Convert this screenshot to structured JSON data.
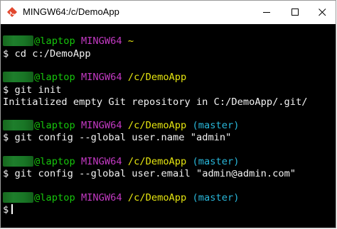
{
  "window": {
    "title": "MINGW64:/c/DemoApp"
  },
  "titlebar_controls": {
    "minimize": "minimize",
    "maximize": "maximize",
    "close": "close"
  },
  "terminal": {
    "user_redacted": true,
    "host": "@laptop",
    "shell": "MINGW64",
    "prompt_symbol": "$",
    "blocks": [
      {
        "path": "~",
        "branch": "",
        "command": "cd c:/DemoApp",
        "output": ""
      },
      {
        "path": "/c/DemoApp",
        "branch": "",
        "command": "git init",
        "output": "Initialized empty Git repository in C:/DemoApp/.git/"
      },
      {
        "path": "/c/DemoApp",
        "branch": "(master)",
        "command": "git config --global user.name \"admin\"",
        "output": ""
      },
      {
        "path": "/c/DemoApp",
        "branch": "(master)",
        "command": "git config --global user.email \"admin@admin.com\"",
        "output": ""
      },
      {
        "path": "/c/DemoApp",
        "branch": "(master)",
        "command": "",
        "output": ""
      }
    ]
  },
  "colors": {
    "user_host": "#16c60c",
    "shell": "#c239c2",
    "path": "#e5e510",
    "branch": "#29b8db",
    "text": "#f2f2f2",
    "background": "#000000"
  }
}
